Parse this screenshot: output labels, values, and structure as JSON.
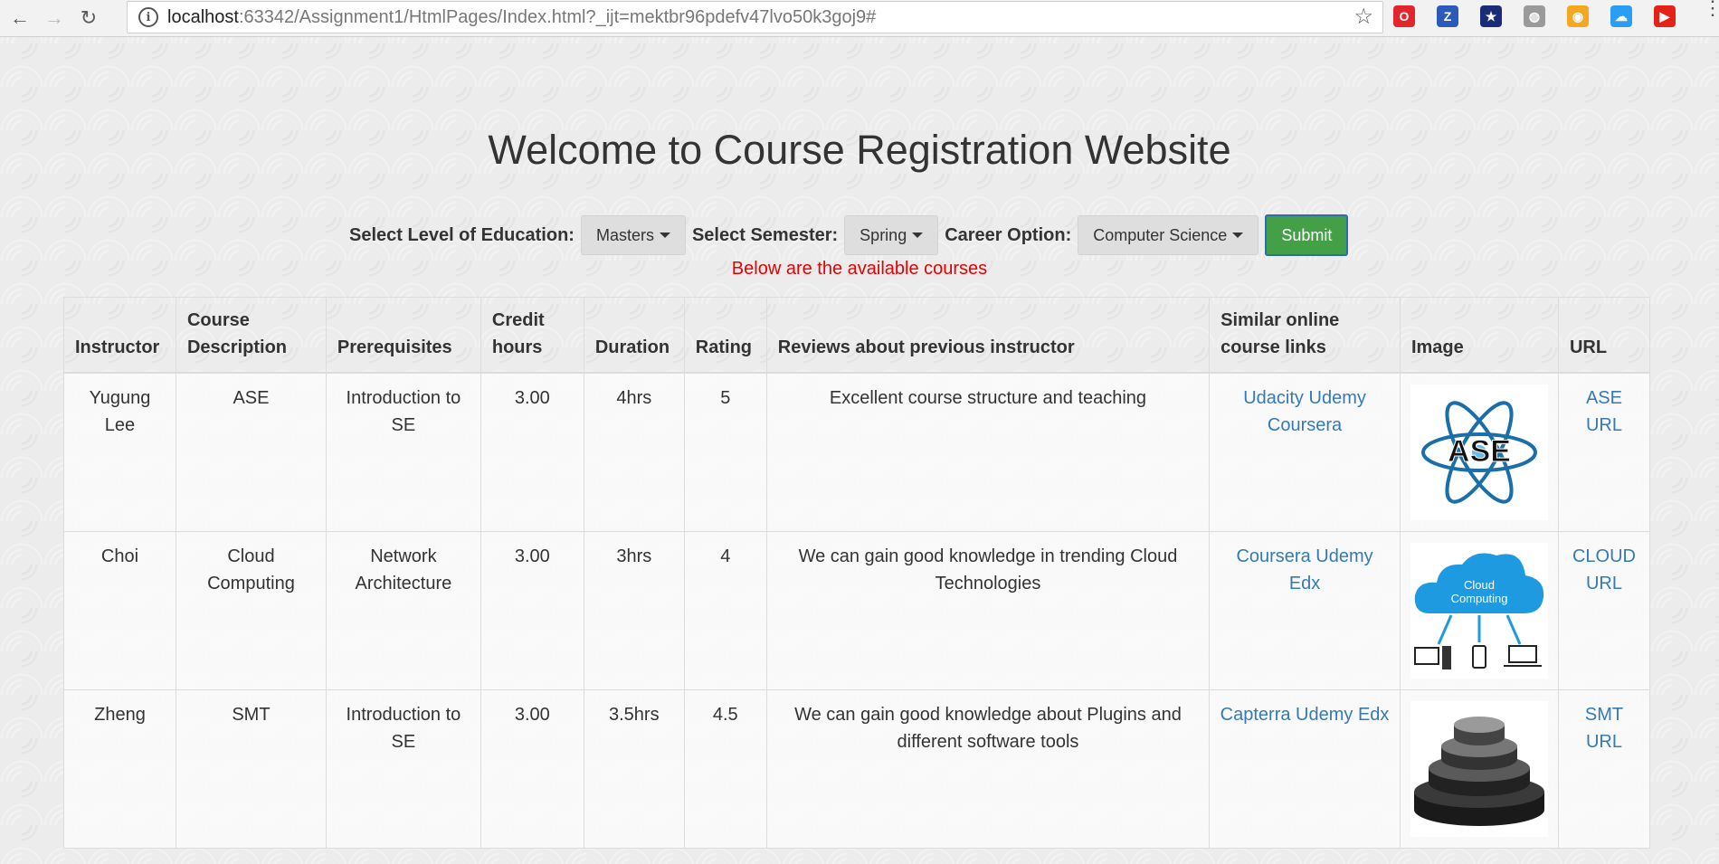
{
  "browser": {
    "url_host": "localhost",
    "url_rest": ":63342/Assignment1/HtmlPages/Index.html?_ijt=mektbr96pdefv47lvo50k3goj9#",
    "extensions": [
      {
        "name": "opera-icon",
        "color": "#e3262e",
        "glyph": "O"
      },
      {
        "name": "zotero-icon",
        "color": "#2b5bb8",
        "glyph": "Z"
      },
      {
        "name": "flag-icon",
        "color": "#1a2b7a",
        "glyph": "★"
      },
      {
        "name": "globe-icon",
        "color": "#9a9a9a",
        "glyph": "◍"
      },
      {
        "name": "shopping-icon",
        "color": "#f5a623",
        "glyph": "◉"
      },
      {
        "name": "cloud-icon",
        "color": "#2a9df4",
        "glyph": "☁"
      },
      {
        "name": "youtube-icon",
        "color": "#e62117",
        "glyph": "▶"
      }
    ]
  },
  "page": {
    "title": "Welcome to Course Registration Website",
    "education_label": "Select Level of Education:",
    "education_value": "Masters",
    "semester_label": "Select Semester:",
    "semester_value": "Spring",
    "career_label": "Career Option:",
    "career_value": "Computer Science",
    "submit_label": "Submit",
    "available_text": "Below are the available courses"
  },
  "table": {
    "headers": {
      "instructor": "Instructor",
      "course_description": "Course Description",
      "prerequisites": "Prerequisites",
      "credit_hours": "Credit hours",
      "duration": "Duration",
      "rating": "Rating",
      "reviews": "Reviews about previous instructor",
      "similar_links": "Similar online course links",
      "image": "Image",
      "url": "URL"
    },
    "rows": [
      {
        "instructor": "Yugung Lee",
        "course": "ASE",
        "prereq": "Introduction to SE",
        "credit": "3.00",
        "duration": "4hrs",
        "rating": "5",
        "review": "Excellent course structure and teaching",
        "links": [
          "Udacity",
          "Udemy",
          "Coursera"
        ],
        "image_text": "ASE",
        "url": "ASE URL"
      },
      {
        "instructor": "Choi",
        "course": "Cloud Computing",
        "prereq": "Network Architecture",
        "credit": "3.00",
        "duration": "3hrs",
        "rating": "4",
        "review": "We can gain good knowledge in trending Cloud Technologies",
        "links": [
          "Coursera",
          "Udemy",
          "Edx"
        ],
        "image_text": "Cloud Computing",
        "url": "CLOUD URL"
      },
      {
        "instructor": "Zheng",
        "course": "SMT",
        "prereq": "Introduction to SE",
        "credit": "3.00",
        "duration": "3.5hrs",
        "rating": "4.5",
        "review": "We can gain good knowledge about Plugins and different software tools",
        "links": [
          "Capterra",
          "Udemy",
          "Edx"
        ],
        "image_text": "",
        "url": "SMT URL"
      }
    ]
  }
}
